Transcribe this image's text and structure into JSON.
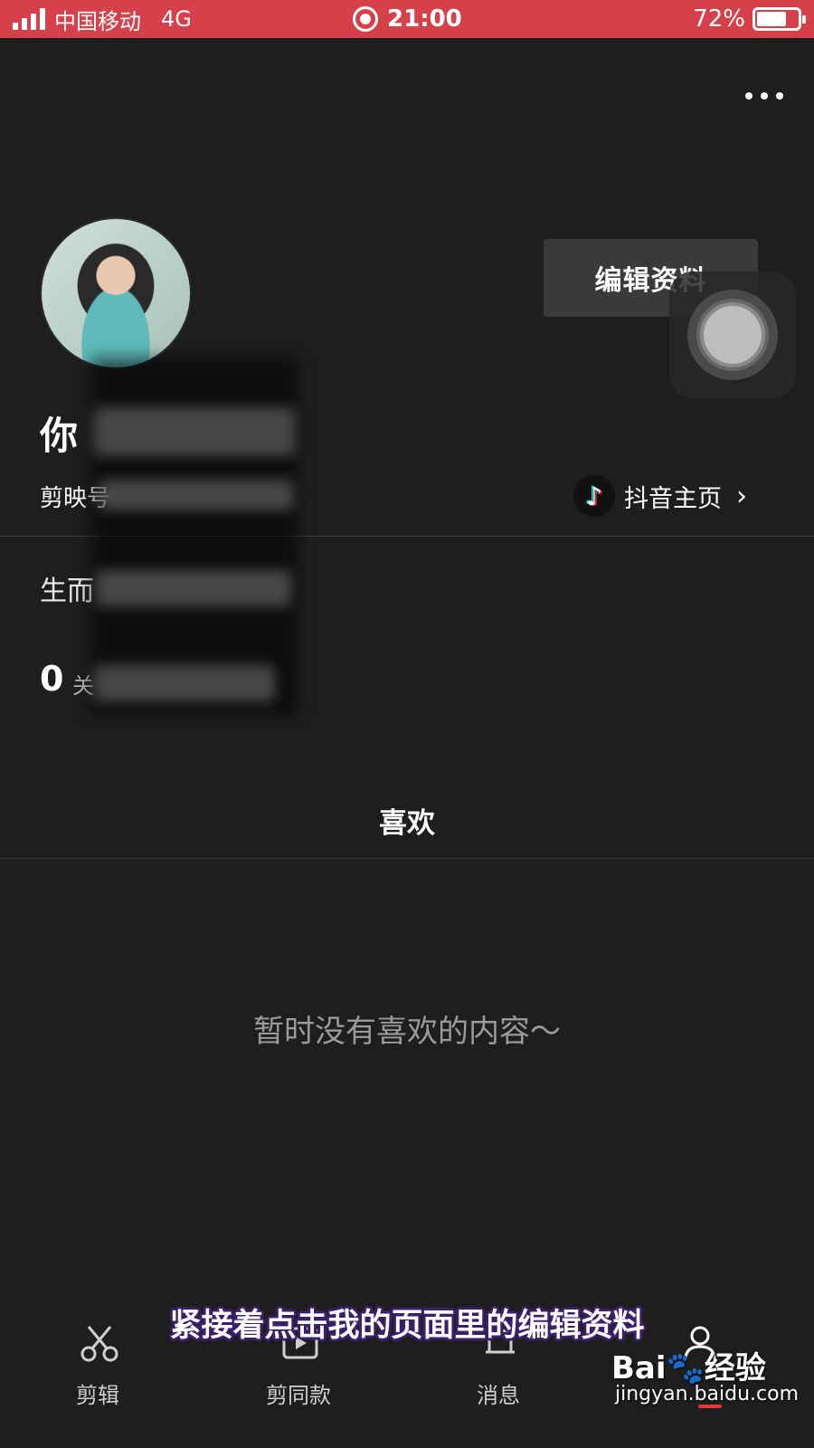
{
  "status_bar": {
    "carrier": "中国移动",
    "network": "4G",
    "time": "21:00",
    "battery_percent": "72%",
    "battery_level": 0.72,
    "bg_color": "#d6404a"
  },
  "header": {
    "more_icon": "more-horizontal-icon"
  },
  "profile": {
    "name_visible": "你",
    "id_prefix": "剪映号",
    "bio_visible": "生而",
    "follow_count": "0",
    "follow_label_visible": "关"
  },
  "actions": {
    "edit_profile": "编辑资料",
    "douyin_link": "抖音主页",
    "douyin_icon": "douyin-logo-icon",
    "chevron_icon": "chevron-right-icon"
  },
  "tabs": {
    "like": "喜欢"
  },
  "empty_state": {
    "message": "暂时没有喜欢的内容～"
  },
  "bottom_nav": {
    "items": [
      {
        "label": "剪辑",
        "icon": "scissors-icon"
      },
      {
        "label": "剪同款",
        "icon": "play-template-icon"
      },
      {
        "label": "消息",
        "icon": "bell-icon"
      },
      {
        "label": "",
        "icon": "person-icon"
      }
    ]
  },
  "caption": "紧接着点击我的页面里的编辑资料",
  "watermark": {
    "logo_text": "经验",
    "url": "jingyan.baidu.com"
  }
}
